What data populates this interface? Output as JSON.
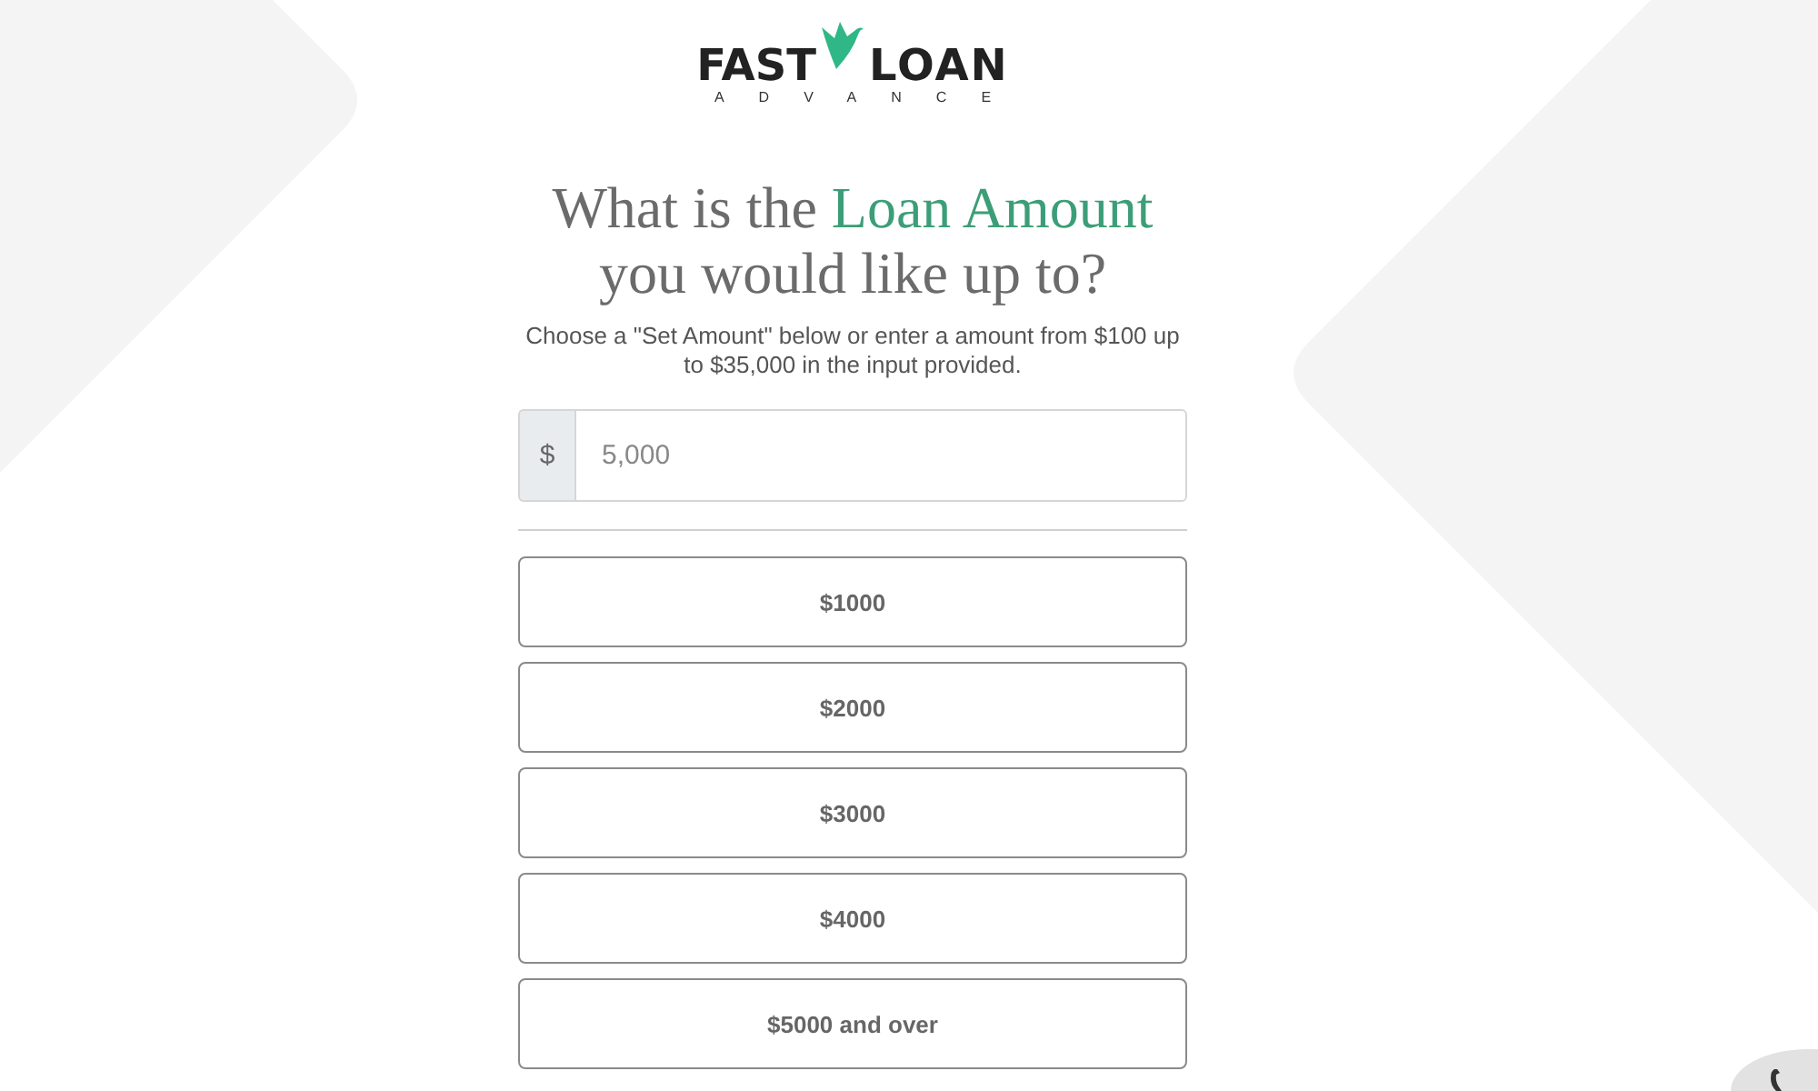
{
  "logo": {
    "word_1": "FAST",
    "word_2": "LOAN",
    "tagline": "ADVANCE"
  },
  "heading": {
    "before": "What is the",
    "highlight": "Loan Amount",
    "after": "you would like up to?"
  },
  "subtitle": "Choose a \"Set Amount\" below or enter a amount from $100 up to $35,000 in the input provided.",
  "amount_input": {
    "prefix": "$",
    "placeholder": "5,000"
  },
  "amount_options": [
    {
      "label": "$1000",
      "selected": false
    },
    {
      "label": "$2000",
      "selected": false
    },
    {
      "label": "$3000",
      "selected": false
    },
    {
      "label": "$4000",
      "selected": false
    },
    {
      "label": "$5000 and over",
      "selected": false
    }
  ]
}
